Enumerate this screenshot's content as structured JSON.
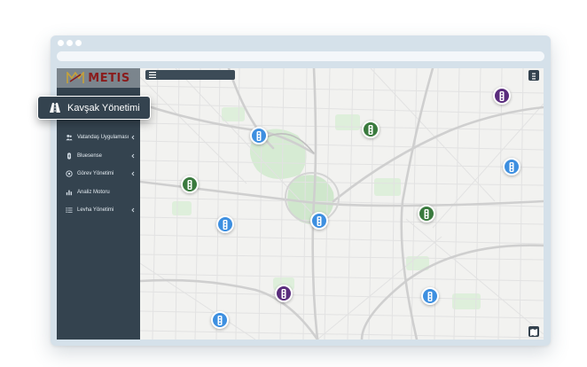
{
  "app": {
    "logo_text": "METIS"
  },
  "callout": {
    "label": "Kavşak Yönetimi",
    "icon": "road-icon"
  },
  "sidebar": {
    "items": [
      {
        "label": "Vatandaş Uygulaması",
        "icon": "users-icon",
        "has_submenu": true
      },
      {
        "label": "Bluesense",
        "icon": "bluetooth-icon",
        "has_submenu": true
      },
      {
        "label": "Görev Yönetimi",
        "icon": "target-icon",
        "has_submenu": true
      },
      {
        "label": "Analiz Motoru",
        "icon": "bar-chart-icon",
        "has_submenu": false
      },
      {
        "label": "Levha Yönetimi",
        "icon": "list-icon",
        "has_submenu": true
      }
    ]
  },
  "map": {
    "markers": [
      {
        "type": "traffic-light",
        "status": "blue"
      },
      {
        "type": "traffic-light",
        "status": "green"
      },
      {
        "type": "traffic-light",
        "status": "purple"
      },
      {
        "type": "traffic-light",
        "status": "blue"
      },
      {
        "type": "traffic-light",
        "status": "green"
      },
      {
        "type": "traffic-light",
        "status": "blue"
      },
      {
        "type": "traffic-light",
        "status": "blue"
      },
      {
        "type": "traffic-light",
        "status": "green"
      },
      {
        "type": "traffic-light",
        "status": "purple"
      },
      {
        "type": "traffic-light",
        "status": "blue"
      },
      {
        "type": "traffic-light",
        "status": "blue"
      }
    ]
  },
  "colors": {
    "sidebar_bg": "#34434f",
    "logo_bg": "#7b858d",
    "logo_text": "#8a1c1c",
    "marker_blue": "#3d8fe0",
    "marker_green": "#3a7a3e",
    "marker_purple": "#5a2c7d"
  }
}
